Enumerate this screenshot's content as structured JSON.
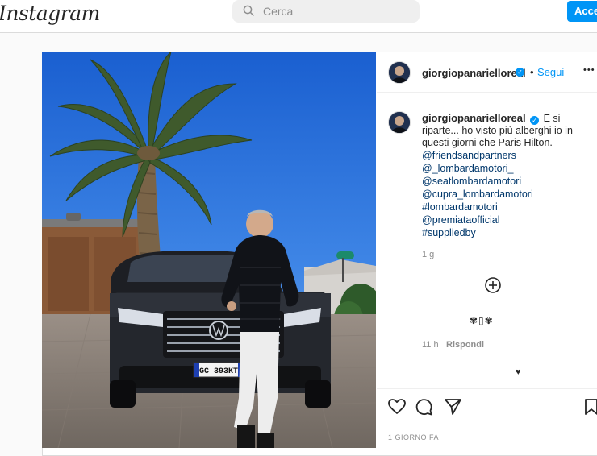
{
  "app": {
    "logo_text": "Instagram"
  },
  "search": {
    "placeholder": "Cerca"
  },
  "header": {
    "login_label": "Accedi"
  },
  "post": {
    "username": "giorgiopanarielloreal",
    "separator": "•",
    "follow_label": "Segui",
    "more_label": "•••",
    "caption_text": "E si riparte... ho visto più alberghi io in questi giorni che Paris Hilton.",
    "tags": [
      "@friendsandpartners",
      "@_lombardamotori_",
      "@seatlombardamotori",
      "@cupra_lombardamotori",
      "#lombardamotori",
      "@premiataofficial",
      "#suppliedby"
    ],
    "caption_age": "1 g",
    "comment_emoji": "✾▯✾",
    "comment_age": "11 h",
    "reply_label": "Rispondi",
    "posted_when": "1 GIORNO FA",
    "license_plate": "GC 393KT"
  },
  "colors": {
    "accent": "#0095f6",
    "link": "#00376b",
    "muted": "#8e8e8e"
  },
  "icons": {
    "search": "search-icon",
    "verified": "verified-badge-icon",
    "like": "heart-icon",
    "comment": "comment-icon",
    "share": "paper-plane-icon",
    "save": "bookmark-icon",
    "add": "plus-circle-icon"
  }
}
